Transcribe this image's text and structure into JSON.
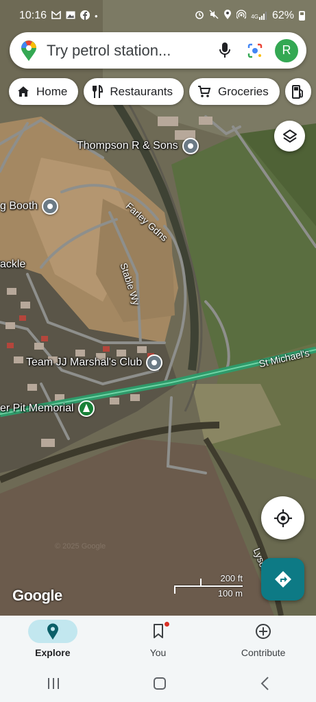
{
  "status_bar": {
    "time": "10:16",
    "notification_icons": [
      "gmail-icon",
      "gallery-icon",
      "facebook-icon",
      "dot-icon"
    ],
    "system_icons": [
      "alarm-icon",
      "mute-icon",
      "location-icon",
      "hotspot-icon",
      "4g-signal-icon"
    ],
    "network_label": "4G",
    "battery": "62%"
  },
  "search": {
    "placeholder": "Try petrol station...",
    "avatar_letter": "R"
  },
  "chips": [
    {
      "label": "Home",
      "icon": "home-icon"
    },
    {
      "label": "Restaurants",
      "icon": "restaurant-icon"
    },
    {
      "label": "Groceries",
      "icon": "cart-icon"
    },
    {
      "label": "",
      "icon": "fuel-icon"
    }
  ],
  "map": {
    "places": [
      {
        "label": "Thompson R & Sons",
        "pin": "grey"
      },
      {
        "label": "g Booth",
        "pin": "grey"
      },
      {
        "label": "ackle",
        "pin": "none"
      },
      {
        "label": "Team JJ Marshal's Club",
        "pin": "grey"
      },
      {
        "label": "er Pit Memorial",
        "pin": "green"
      }
    ],
    "streets": [
      "Farley Gdns",
      "Stable Wy",
      "St Michael's",
      "Lysons"
    ],
    "attribution": "Google",
    "watermark": "© 2025 Google",
    "scale": {
      "imperial": "200 ft",
      "metric": "100 m"
    }
  },
  "bottom_nav": [
    {
      "label": "Explore",
      "icon": "explore-pin-icon",
      "active": true
    },
    {
      "label": "You",
      "icon": "bookmark-icon",
      "active": false,
      "badge": true
    },
    {
      "label": "Contribute",
      "icon": "add-circle-icon",
      "active": false
    }
  ],
  "colors": {
    "accent": "#0d7a85",
    "active_tab_bg": "#c2e7ef",
    "avatar_bg": "#34a853",
    "route_green": "#2f9a6a"
  }
}
